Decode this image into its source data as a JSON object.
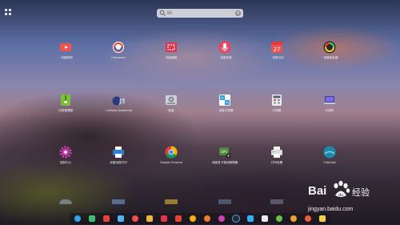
{
  "search": {
    "value": "iri"
  },
  "apps": [
    {
      "label": "深度影院",
      "icon": "video-camera-icon",
      "dot": true
    },
    {
      "label": "Crossover",
      "icon": "crossover-icon",
      "dot": false
    },
    {
      "label": "深度截图",
      "icon": "screenshot-icon",
      "dot": false
    },
    {
      "label": "深度录音",
      "icon": "microphone-icon",
      "dot": true
    },
    {
      "label": "深度日历",
      "icon": "calendar-icon",
      "dot": true
    },
    {
      "label": "深度取色器",
      "icon": "color-picker-icon",
      "dot": true
    },
    {
      "label": "归档管理器",
      "icon": "archive-icon",
      "dot": false
    },
    {
      "label": "eclipse-javascript",
      "icon": "eclipse-js-icon",
      "dot": true
    },
    {
      "label": "磁盘",
      "icon": "disk-icon",
      "dot": false
    },
    {
      "label": "深度计算器",
      "icon": "calculator-icon",
      "dot": true
    },
    {
      "label": "计算器",
      "icon": "calculator-alt-icon",
      "dot": false
    },
    {
      "label": "计算机",
      "icon": "computer-icon",
      "dot": false
    },
    {
      "label": "控制中心",
      "icon": "settings-gear-icon",
      "dot": false
    },
    {
      "label": "深度远程打印",
      "icon": "remote-print-icon",
      "dot": false
    },
    {
      "label": "Google Chrome",
      "icon": "chrome-icon",
      "dot": false
    },
    {
      "label": "深度显卡驱动管理器",
      "icon": "gpu-driver-icon",
      "dot": false
    },
    {
      "label": "打印设置",
      "icon": "printer-icon",
      "dot": false
    },
    {
      "label": "ClipGrab",
      "icon": "clipgrab-icon",
      "dot": false
    }
  ],
  "dock": [
    "launcher-icon",
    "file-manager-icon",
    "deepin-store-icon",
    "clipboard-icon",
    "music-icon",
    "video-icon",
    "photo-icon",
    "chrome-icon",
    "firefox-icon",
    "control-center-icon",
    "terminal-icon",
    "network-icon",
    "monitor-icon",
    "qq-icon",
    "notes-icon",
    "music-player-icon",
    "gear-icon",
    "trash-icon"
  ],
  "watermark": {
    "brand": "Bai",
    "brand2": "经验",
    "url": "jingyan.baidu.com"
  }
}
